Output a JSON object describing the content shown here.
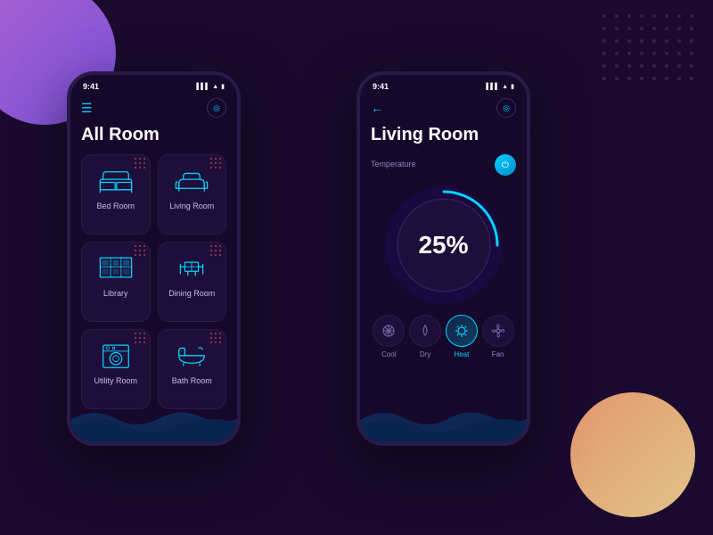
{
  "background": {
    "color": "#1a0a2e"
  },
  "phone_left": {
    "status": {
      "time": "9:41",
      "icons": [
        "signal",
        "wifi",
        "battery"
      ]
    },
    "title": "All Room",
    "menu_icon": "☰",
    "location_icon": "◎",
    "rooms": [
      {
        "name": "Bed Room",
        "icon": "bed"
      },
      {
        "name": "Living Room",
        "icon": "sofa"
      },
      {
        "name": "Library",
        "icon": "bookshelf"
      },
      {
        "name": "Dining Room",
        "icon": "dining"
      },
      {
        "name": "Utility Room",
        "icon": "washer"
      },
      {
        "name": "Bath Room",
        "icon": "bath"
      }
    ]
  },
  "phone_right": {
    "status": {
      "time": "9:41",
      "icons": [
        "signal",
        "wifi",
        "battery"
      ]
    },
    "title": "Living Room",
    "back_label": "←",
    "section_label": "Temperature",
    "temp_value": "25%",
    "controls": [
      {
        "name": "Cool",
        "icon": "❄",
        "active": false
      },
      {
        "name": "Dry",
        "icon": "💧",
        "active": false
      },
      {
        "name": "Heat",
        "icon": "☀",
        "active": true
      },
      {
        "name": "Fan",
        "icon": "🌀",
        "active": false
      }
    ]
  }
}
